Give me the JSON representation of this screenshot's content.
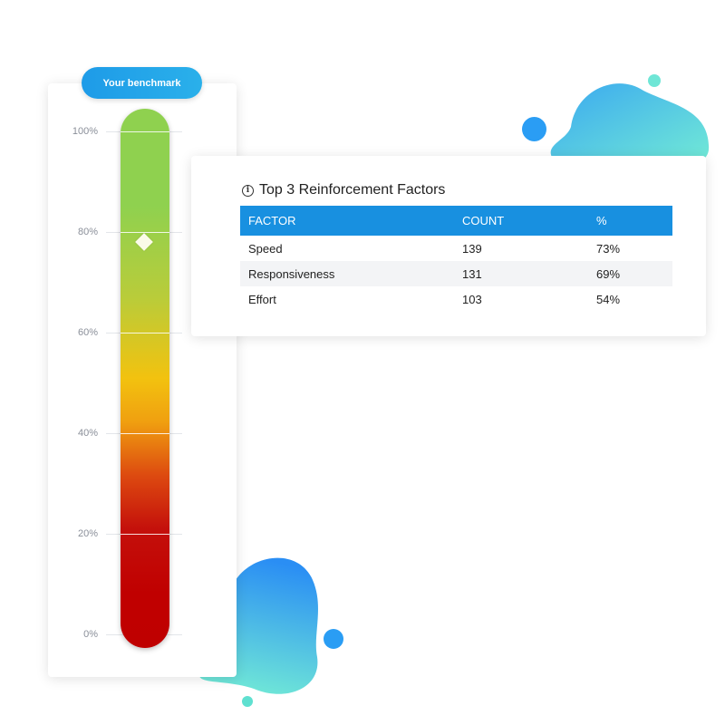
{
  "benchmark": {
    "label": "Your benchmark",
    "value_percent": 78,
    "ticks": [
      "100%",
      "80%",
      "60%",
      "40%",
      "20%",
      "0%"
    ]
  },
  "table": {
    "title": "Top 3 Reinforcement Factors",
    "columns": [
      "FACTOR",
      "COUNT",
      "%"
    ],
    "rows": [
      {
        "factor": "Speed",
        "count": "139",
        "percent": "73%"
      },
      {
        "factor": "Responsiveness",
        "count": "131",
        "percent": "69%"
      },
      {
        "factor": "Effort",
        "count": "103",
        "percent": "54%"
      }
    ]
  },
  "colors": {
    "accent": "#1890e0",
    "gauge_top": "#8fd14f",
    "gauge_mid": "#f2c20f",
    "gauge_bottom": "#bf0000",
    "blob_blue": "#2a9df4",
    "blob_teal": "#6fe6d6"
  },
  "icons": {
    "info": "info-icon"
  }
}
